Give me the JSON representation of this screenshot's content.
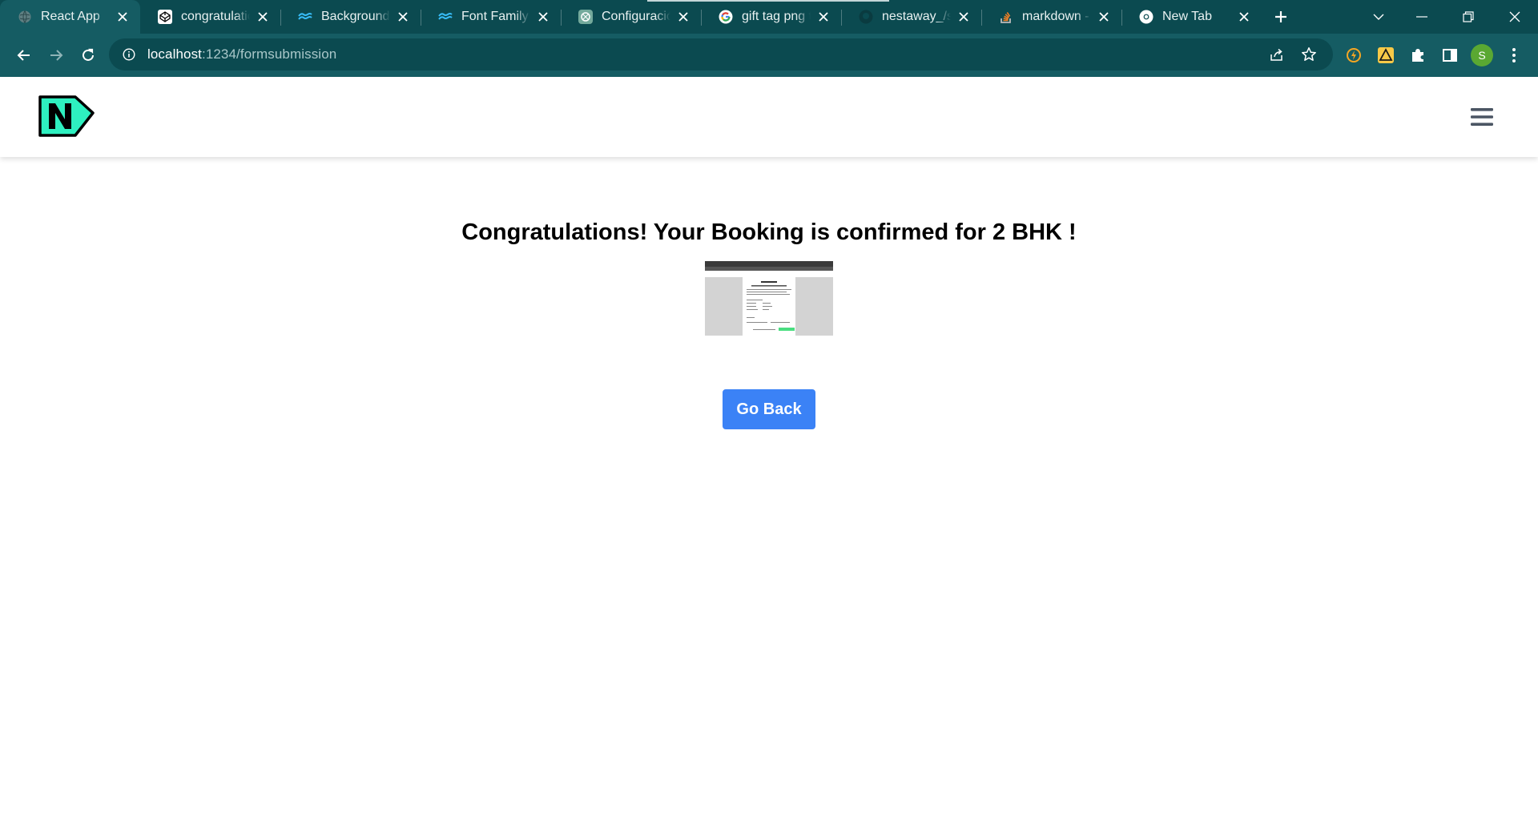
{
  "browser": {
    "tabs": [
      {
        "title": "React App",
        "icon": "globe-icon"
      },
      {
        "title": "congratulations",
        "icon": "codepen-icon"
      },
      {
        "title": "Background Color",
        "icon": "tailwind-icon"
      },
      {
        "title": "Font Family - Tailwind",
        "icon": "tailwind-icon"
      },
      {
        "title": "Configuración",
        "icon": "chatgpt-icon"
      },
      {
        "title": "gift tag png transparent",
        "icon": "google-icon"
      },
      {
        "title": "nestaway_/src",
        "icon": "github-icon"
      },
      {
        "title": "markdown - Stack",
        "icon": "stackoverflow-icon"
      },
      {
        "title": "New Tab",
        "icon": "chrome-icon"
      }
    ],
    "url_host": "localhost",
    "url_path": ":1234/formsubmission",
    "profile_initial": "S",
    "colors": {
      "tab_strip": "#0b4a50",
      "toolbar": "#155c63"
    }
  },
  "page": {
    "headline": "Congratulations! Your Booking is confirmed for 2 BHK !",
    "go_back_label": "Go Back",
    "colors": {
      "logo_accent": "#2ef0c0",
      "button": "#3b82f6"
    }
  }
}
